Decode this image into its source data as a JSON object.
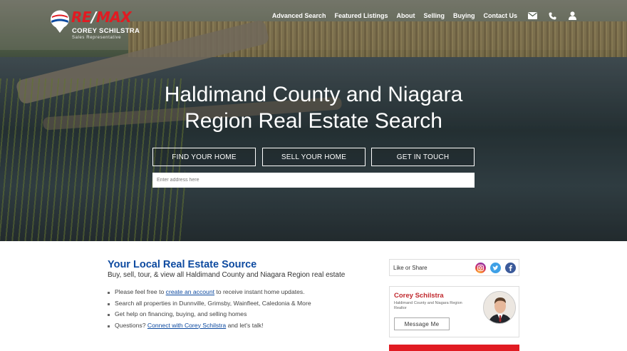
{
  "brand": {
    "logo_text": "RE/MAX",
    "agent_name": "COREY SCHILSTRA",
    "agent_role": "Sales Representative",
    "colors": {
      "red": "#e11b22",
      "blue": "#0d4aa0"
    }
  },
  "nav": {
    "links": [
      "Advanced Search",
      "Featured Listings",
      "About",
      "Selling",
      "Buying",
      "Contact Us"
    ],
    "icons": [
      "envelope-icon",
      "phone-icon",
      "user-icon"
    ]
  },
  "hero": {
    "title_line1": "Haldimand County and Niagara",
    "title_line2": "Region Real Estate Search",
    "buttons": [
      "FIND YOUR HOME",
      "SELL YOUR HOME",
      "GET IN TOUCH"
    ],
    "search_placeholder": "Enter address here"
  },
  "main": {
    "title": "Your Local Real Estate Source",
    "subtitle": "Buy, sell, tour, & view all Haldimand County and Niagara Region real estate",
    "bullets": [
      {
        "before": "Please feel free to ",
        "link": "create an account",
        "after": " to receive instant home updates."
      },
      {
        "before": "Search all properties in Dunnville, Grimsby, Wainfleet, Caledonia & More",
        "link": "",
        "after": ""
      },
      {
        "before": "Get help on financing, buying, and selling homes",
        "link": "",
        "after": ""
      },
      {
        "before": "Questions? ",
        "link": "Connect with Corey Schilstra",
        "after": " and let's talk!"
      }
    ]
  },
  "sidebar": {
    "share_label": "Like or Share",
    "social_icons": [
      "instagram-icon",
      "twitter-icon",
      "facebook-icon"
    ],
    "agent_card": {
      "name": "Corey Schilstra",
      "description": "Haldimand County and Niagara Region Realtor",
      "button": "Message Me"
    }
  }
}
